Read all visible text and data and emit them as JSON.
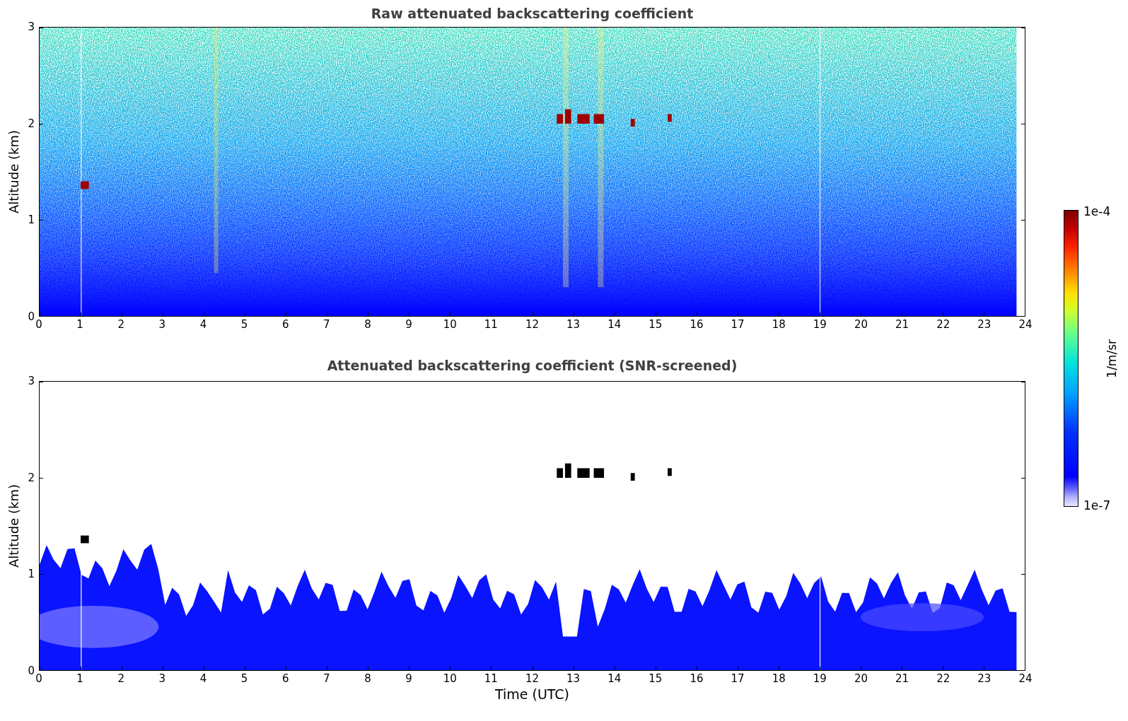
{
  "panels": [
    {
      "kind": "raw",
      "title": "Raw attenuated backscattering coefficient",
      "ylabel": "Altitude (km)",
      "yticks": [
        "3",
        "2",
        "1",
        "0"
      ],
      "xticks": [
        "0",
        "1",
        "2",
        "3",
        "4",
        "5",
        "6",
        "7",
        "8",
        "9",
        "10",
        "11",
        "12",
        "13",
        "14",
        "15",
        "16",
        "17",
        "18",
        "19",
        "20",
        "21",
        "22",
        "23",
        "24"
      ]
    },
    {
      "kind": "screened",
      "title": "Attenuated backscattering coefficient (SNR-screened)",
      "ylabel": "Altitude (km)",
      "yticks": [
        "3",
        "2",
        "1",
        "0"
      ],
      "xticks": [
        "0",
        "1",
        "2",
        "3",
        "4",
        "5",
        "6",
        "7",
        "8",
        "9",
        "10",
        "11",
        "12",
        "13",
        "14",
        "15",
        "16",
        "17",
        "18",
        "19",
        "20",
        "21",
        "22",
        "23",
        "24"
      ]
    }
  ],
  "xlabel": "Time (UTC)",
  "colorbar": {
    "max_label": "1e-4",
    "min_label": "1e-7",
    "unit": "1/m/sr"
  }
}
